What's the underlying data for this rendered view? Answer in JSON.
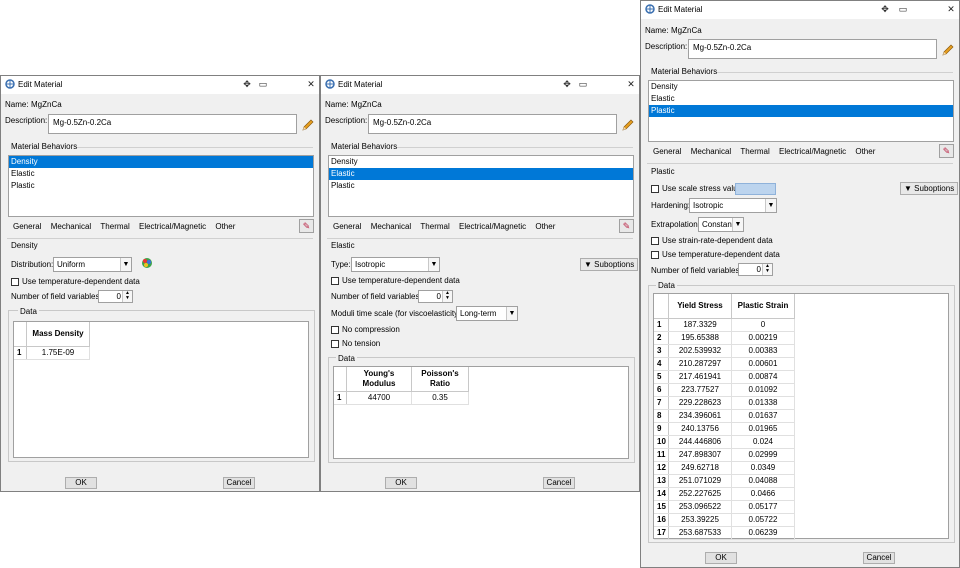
{
  "colors": {
    "selection": "#0078d7",
    "dialog_bg": "#f0f0f0",
    "scale_box": "#bcd4ee"
  },
  "icons": {
    "title": "edit-material-icon",
    "pin": "pin-icon",
    "restore": "restore-icon",
    "close": "close-icon",
    "pencil": "pencil-icon",
    "color_palette": "color-palette-icon",
    "edit": "edit-table-icon"
  },
  "dialogs": [
    {
      "title": "Edit Material",
      "name_label": "Name:",
      "name_value": "MgZnCa",
      "description_label": "Description:",
      "description_value": "Mg-0.5Zn-0.2Ca",
      "behaviors_label": "Material Behaviors",
      "behaviors": [
        "Density",
        "Elastic",
        "Plastic"
      ],
      "selected_behavior": "Density",
      "menu": [
        "General",
        "Mechanical",
        "Thermal",
        "Electrical/Magnetic",
        "Other"
      ],
      "section_title": "Density",
      "distribution_label": "Distribution:",
      "distribution_value": "Uniform",
      "temp_dep_label": "Use temperature-dependent data",
      "field_vars_label": "Number of field variables:",
      "field_vars_value": "0",
      "data_label": "Data",
      "table": {
        "headers": [
          "Mass Density"
        ],
        "rows": [
          {
            "n": "1",
            "cells": [
              "1.75E-09"
            ]
          }
        ]
      },
      "ok": "OK",
      "cancel": "Cancel"
    },
    {
      "title": "Edit Material",
      "name_label": "Name:",
      "name_value": "MgZnCa",
      "description_label": "Description:",
      "description_value": "Mg-0.5Zn-0.2Ca",
      "behaviors_label": "Material Behaviors",
      "behaviors": [
        "Density",
        "Elastic",
        "Plastic"
      ],
      "selected_behavior": "Elastic",
      "menu": [
        "General",
        "Mechanical",
        "Thermal",
        "Electrical/Magnetic",
        "Other"
      ],
      "section_title": "Elastic",
      "type_label": "Type:",
      "type_value": "Isotropic",
      "suboptions": "Suboptions",
      "temp_dep_label": "Use temperature-dependent data",
      "field_vars_label": "Number of field variables:",
      "field_vars_value": "0",
      "moduli_label": "Moduli time scale (for viscoelasticity):",
      "moduli_value": "Long-term",
      "no_compression": "No compression",
      "no_tension": "No tension",
      "data_label": "Data",
      "table": {
        "headers": [
          "Young's Modulus",
          "Poisson's Ratio"
        ],
        "rows": [
          {
            "n": "1",
            "cells": [
              "44700",
              "0.35"
            ]
          }
        ]
      },
      "ok": "OK",
      "cancel": "Cancel"
    },
    {
      "title": "Edit Material",
      "name_label": "Name:",
      "name_value": "MgZnCa",
      "description_label": "Description:",
      "description_value": "Mg-0.5Zn-0.2Ca",
      "behaviors_label": "Material Behaviors",
      "behaviors": [
        "Density",
        "Elastic",
        "Plastic"
      ],
      "selected_behavior": "Plastic",
      "menu": [
        "General",
        "Mechanical",
        "Thermal",
        "Electrical/Magnetic",
        "Other"
      ],
      "section_title": "Plastic",
      "scale_stress_label": "Use scale stress value:",
      "suboptions": "Suboptions",
      "hardening_label": "Hardening:",
      "hardening_value": "Isotropic",
      "extrapolation_label": "Extrapolation:",
      "extrapolation_value": "Constant",
      "strain_rate_label": "Use strain-rate-dependent data",
      "temp_dep_label": "Use temperature-dependent data",
      "field_vars_label": "Number of field variables:",
      "field_vars_value": "0",
      "data_label": "Data",
      "table": {
        "headers": [
          "Yield Stress",
          "Plastic Strain"
        ],
        "rows": [
          {
            "n": "1",
            "cells": [
              "187.3329",
              "0"
            ]
          },
          {
            "n": "2",
            "cells": [
              "195.65388",
              "0.00219"
            ]
          },
          {
            "n": "3",
            "cells": [
              "202.539932",
              "0.00383"
            ]
          },
          {
            "n": "4",
            "cells": [
              "210.287297",
              "0.00601"
            ]
          },
          {
            "n": "5",
            "cells": [
              "217.461941",
              "0.00874"
            ]
          },
          {
            "n": "6",
            "cells": [
              "223.77527",
              "0.01092"
            ]
          },
          {
            "n": "7",
            "cells": [
              "229.228623",
              "0.01338"
            ]
          },
          {
            "n": "8",
            "cells": [
              "234.396061",
              "0.01637"
            ]
          },
          {
            "n": "9",
            "cells": [
              "240.13756",
              "0.01965"
            ]
          },
          {
            "n": "10",
            "cells": [
              "244.446806",
              "0.024"
            ]
          },
          {
            "n": "11",
            "cells": [
              "247.898307",
              "0.02999"
            ]
          },
          {
            "n": "12",
            "cells": [
              "249.62718",
              "0.0349"
            ]
          },
          {
            "n": "13",
            "cells": [
              "251.071029",
              "0.04088"
            ]
          },
          {
            "n": "14",
            "cells": [
              "252.227625",
              "0.0466"
            ]
          },
          {
            "n": "15",
            "cells": [
              "253.096522",
              "0.05177"
            ]
          },
          {
            "n": "16",
            "cells": [
              "253.39225",
              "0.05722"
            ]
          },
          {
            "n": "17",
            "cells": [
              "253.687533",
              "0.06239"
            ]
          }
        ]
      },
      "ok": "OK",
      "cancel": "Cancel"
    }
  ]
}
